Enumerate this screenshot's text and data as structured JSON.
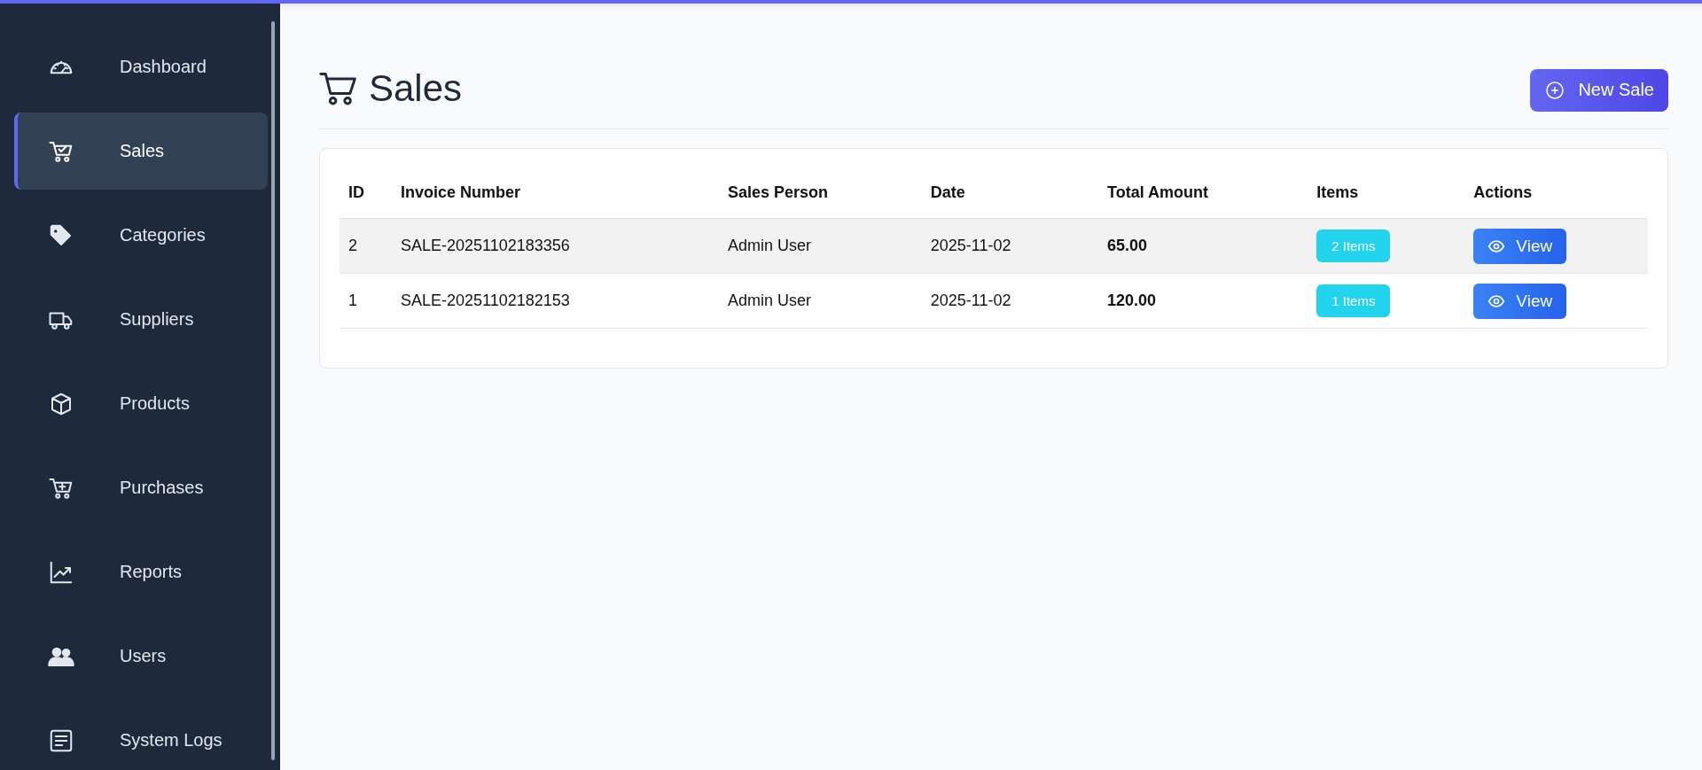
{
  "sidebar": {
    "items": [
      {
        "label": "Dashboard",
        "selected": false
      },
      {
        "label": "Sales",
        "selected": true
      },
      {
        "label": "Categories",
        "selected": false
      },
      {
        "label": "Suppliers",
        "selected": false
      },
      {
        "label": "Products",
        "selected": false
      },
      {
        "label": "Purchases",
        "selected": false
      },
      {
        "label": "Reports",
        "selected": false
      },
      {
        "label": "Users",
        "selected": false
      },
      {
        "label": "System Logs",
        "selected": false
      }
    ]
  },
  "page": {
    "title": "Sales",
    "new_button": "New Sale"
  },
  "table": {
    "columns": [
      "ID",
      "Invoice Number",
      "Sales Person",
      "Date",
      "Total Amount",
      "Items",
      "Actions"
    ],
    "rows": [
      {
        "id": "2",
        "invoice": "SALE-20251102183356",
        "person": "Admin User",
        "date": "2025-11-02",
        "total": "65.00",
        "items": "2 Items",
        "action": "View",
        "selected": true
      },
      {
        "id": "1",
        "invoice": "SALE-20251102182153",
        "person": "Admin User",
        "date": "2025-11-02",
        "total": "120.00",
        "items": "1 Items",
        "action": "View",
        "selected": false
      }
    ]
  }
}
